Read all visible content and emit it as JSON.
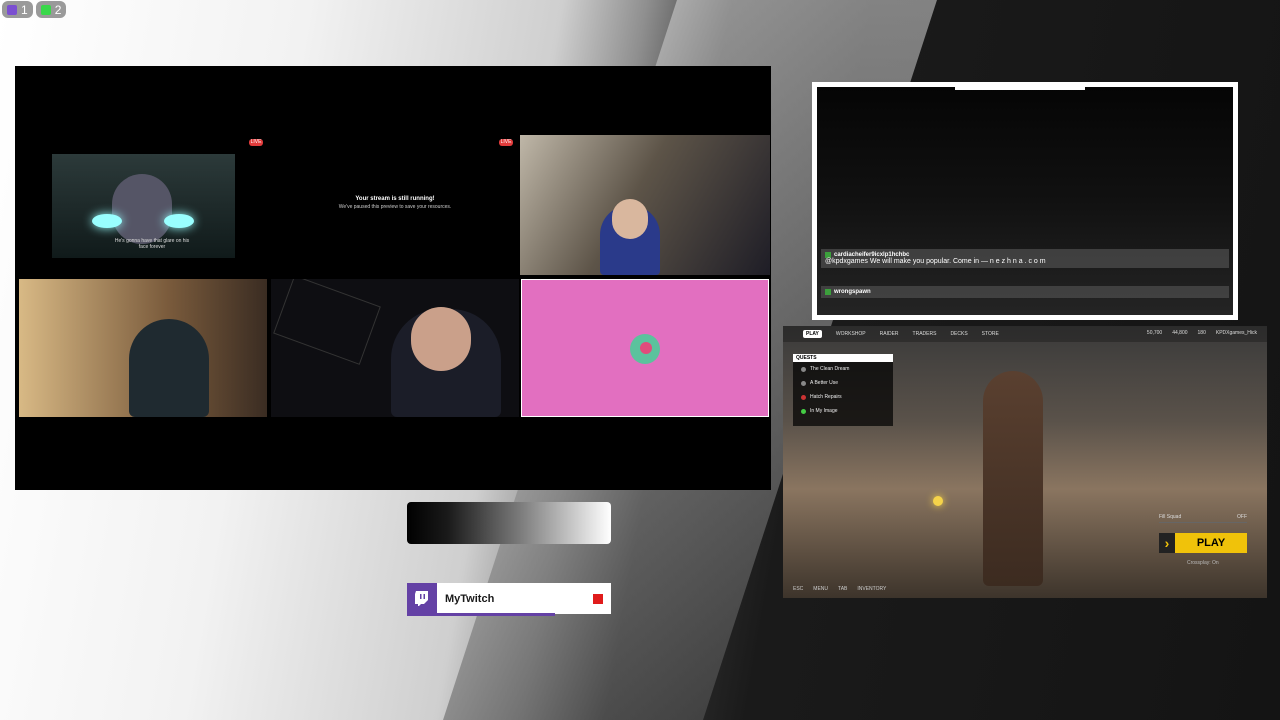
{
  "colors": {
    "accent": "#6441a5",
    "live": "#e13b3b",
    "play": "#f0c20a",
    "pink": "#e26fc0"
  },
  "top_badges": [
    {
      "icon": "twitch-icon",
      "count": "1"
    },
    {
      "icon": "green-leaf-icon",
      "count": "2"
    }
  ],
  "main_panel": {
    "live_tag_1": "LIVE",
    "live_tag_2": "LIVE",
    "paused_title": "Your stream is still running!",
    "paused_sub": "We've paused this preview to save your resources.",
    "anime_subtitle": "He's gonna have that glare on his face forever"
  },
  "chat": {
    "messages": [
      {
        "user": "cardiacheifer9icxlp1hchbc",
        "text": "@kpdxgames We will make you popular. Come in — n e z h n a . c o m"
      },
      {
        "user": "wrongspawn",
        "text": ""
      }
    ]
  },
  "game": {
    "nav": [
      "PLAY",
      "WORKSHOP",
      "RAIDER",
      "TRADERS",
      "DECKS",
      "STORE"
    ],
    "resources": [
      "50,700",
      "44,800",
      "180",
      "KPDXgames_Hick"
    ],
    "quests_header": "QUESTS",
    "quests": [
      "The Clean Dream",
      "A Better Use",
      "Hatch Repairs",
      "In My Image"
    ],
    "fill_squad": "Fill Squad",
    "fill_squad_value": "OFF",
    "play_label": "PLAY",
    "crossplay": "Crossplay: On",
    "footer": [
      "ESC",
      "MENU",
      "TAB",
      "INVENTORY"
    ]
  },
  "twitch_bar": {
    "name": "MyTwitch"
  }
}
